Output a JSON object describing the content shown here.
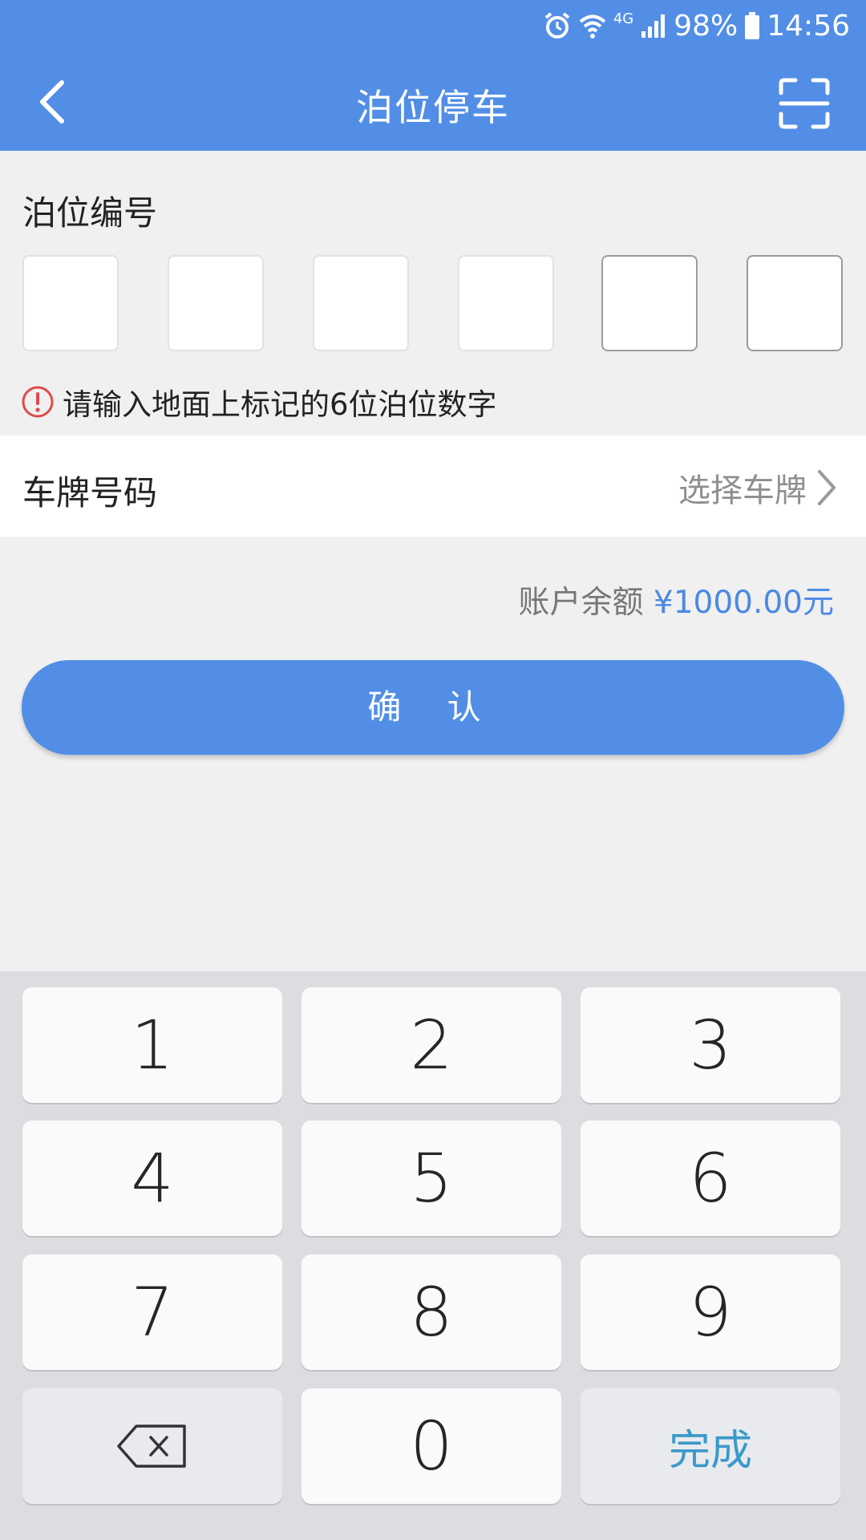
{
  "status_bar": {
    "battery": "98%",
    "time": "14:56",
    "network": "4G"
  },
  "header": {
    "title": "泊位停车",
    "back_icon": "chevron-left-icon",
    "scan_icon": "scan-icon"
  },
  "berth": {
    "label": "泊位编号",
    "hint": "请输入地面上标记的6位泊位数字",
    "digits": [
      "",
      "",
      "",
      "",
      "",
      ""
    ]
  },
  "plate": {
    "label": "车牌号码",
    "select_text": "选择车牌"
  },
  "balance": {
    "label": "账户余额",
    "amount": "¥1000.00元"
  },
  "confirm": {
    "label": "确 认"
  },
  "keypad": {
    "keys": [
      "1",
      "2",
      "3",
      "4",
      "5",
      "6",
      "7",
      "8",
      "9",
      "",
      "0",
      "完成"
    ],
    "backspace_icon": "backspace-icon",
    "done_label": "完成"
  },
  "colors": {
    "primary": "#528ee6",
    "balance_amount": "#4b89e4",
    "hint_icon": "#e04a4a",
    "done_text": "#3a9ac9"
  }
}
